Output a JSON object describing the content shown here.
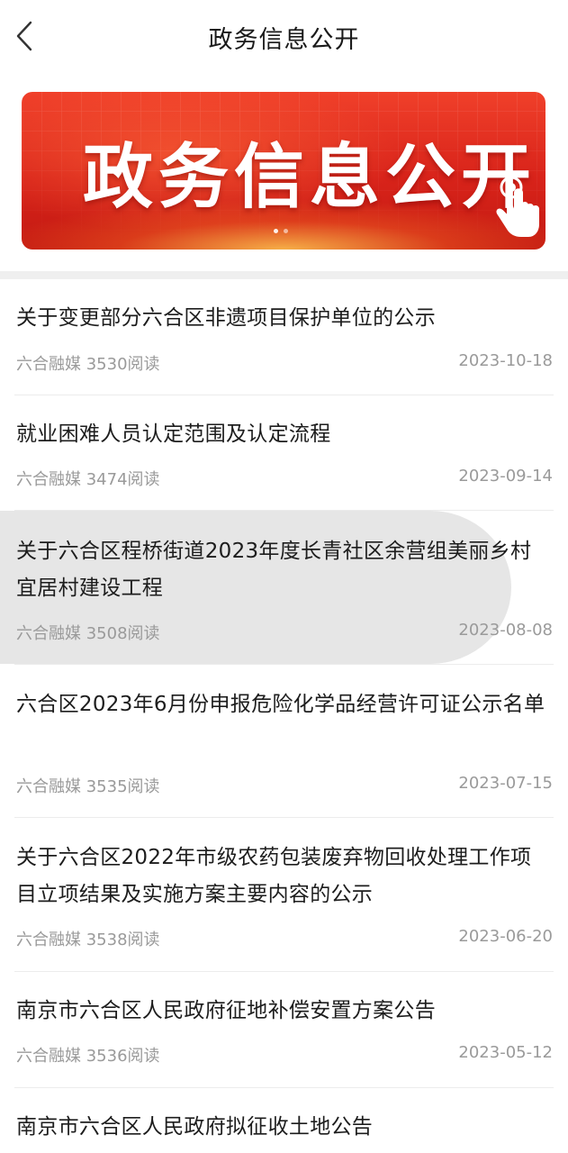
{
  "header": {
    "title": "政务信息公开",
    "back_icon": "chevron-left-icon"
  },
  "banner": {
    "text": "政务信息公开",
    "icon": "hand-pointer-icon",
    "page_count": 2,
    "active_page": 1
  },
  "articles": [
    {
      "title": "关于变更部分六合区非遗项目保护单位的公示",
      "source": "六合融媒",
      "reads": "3530阅读",
      "date": "2023-10-18"
    },
    {
      "title": "就业困难人员认定范围及认定流程",
      "source": "六合融媒",
      "reads": "3474阅读",
      "date": "2023-09-14"
    },
    {
      "title": "关于六合区程桥街道2023年度长青社区余营组美丽乡村宜居村建设工程",
      "source": "六合融媒",
      "reads": "3508阅读",
      "date": "2023-08-08"
    },
    {
      "title": "六合区2023年6月份申报危险化学品经营许可证公示名单",
      "source": "六合融媒",
      "reads": "3535阅读",
      "date": "2023-07-15"
    },
    {
      "title": "关于六合区2022年市级农药包装废弃物回收处理工作项目立项结果及实施方案主要内容的公示",
      "source": "六合融媒",
      "reads": "3538阅读",
      "date": "2023-06-20"
    },
    {
      "title": "南京市六合区人民政府征地补偿安置方案公告",
      "source": "六合融媒",
      "reads": "3536阅读",
      "date": "2023-05-12"
    },
    {
      "title": "南京市六合区人民政府拟征收土地公告",
      "source": "",
      "reads": "",
      "date": ""
    }
  ]
}
